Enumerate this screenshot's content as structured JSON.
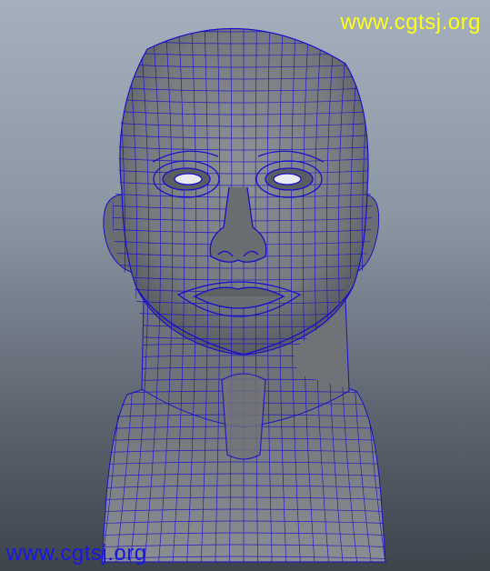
{
  "viewport": {
    "background_top": "#a4b0bd",
    "background_bottom": "#3e444c",
    "mesh_color": "#1a10c8",
    "surface_color": "#7c7f84"
  },
  "model": {
    "icon": "head-wireframe-mesh"
  },
  "watermarks": {
    "top": {
      "text": "www.cgtsj.org",
      "color": "#ffff1a"
    },
    "bottom": {
      "text": "www.cgtsj.org",
      "color": "#1818e0"
    }
  }
}
